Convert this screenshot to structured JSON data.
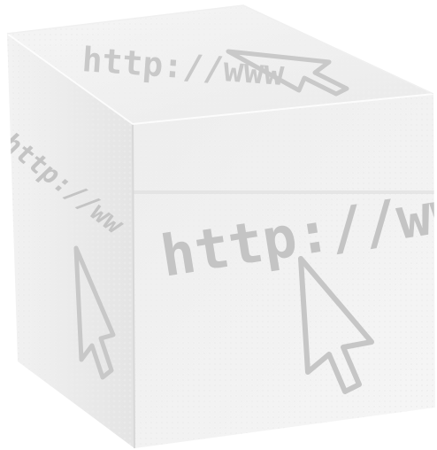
{
  "scene": {
    "subject": "cube",
    "faces": {
      "top": {
        "text": "http://www"
      },
      "left": {
        "text": "http://ww"
      },
      "front": {
        "text": "http://ww"
      }
    },
    "icons": [
      "cursor-arrow-icon",
      "cursor-arrow-icon",
      "cursor-arrow-icon"
    ],
    "colors": {
      "background": "#ffffff",
      "face_light": "#f3f3f3",
      "face_mid": "#e9e9e9",
      "face_dark": "#dcdcdc",
      "glyph": "#c6c6c6"
    }
  }
}
